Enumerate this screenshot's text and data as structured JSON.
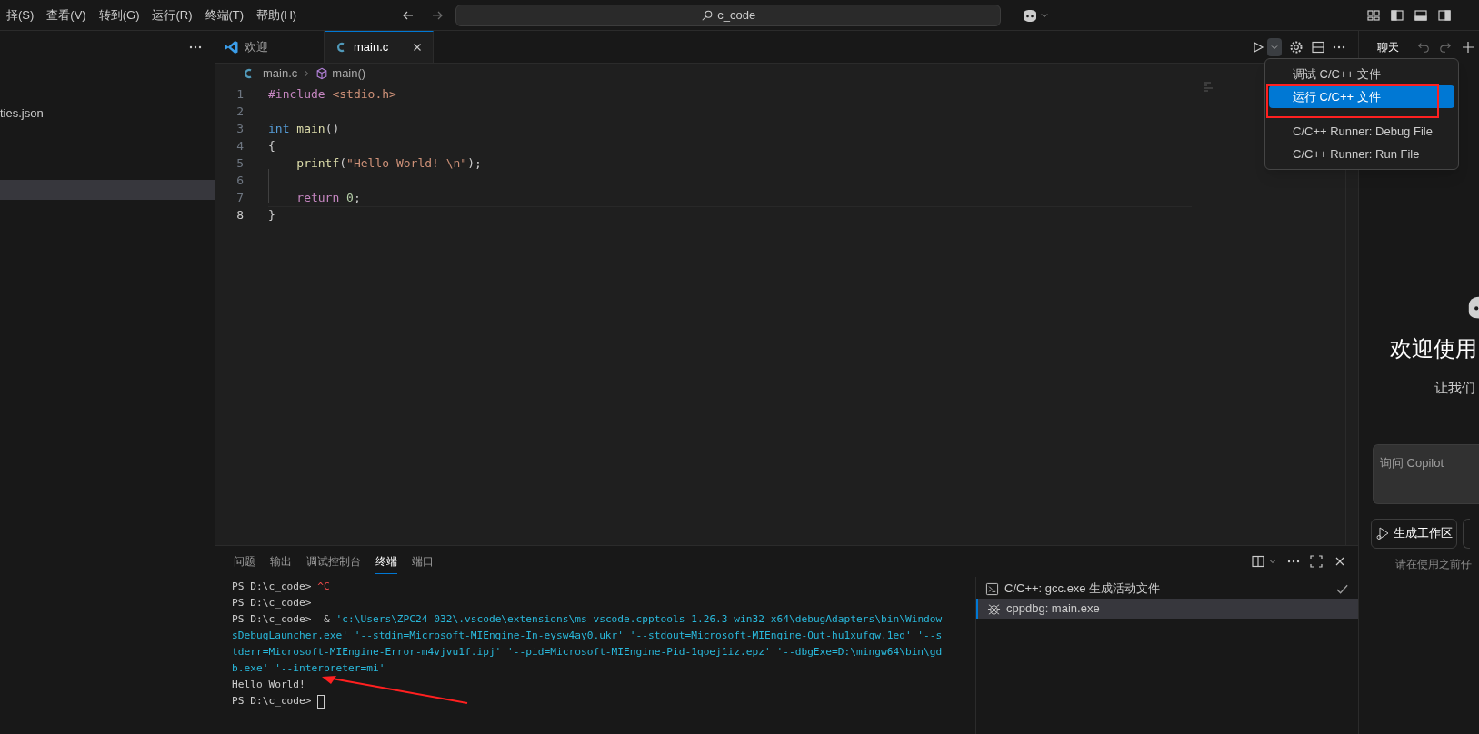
{
  "menu": [
    "择(S)",
    "查看(V)",
    "转到(G)",
    "运行(R)",
    "终端(T)",
    "帮助(H)"
  ],
  "search": {
    "value": "c_code"
  },
  "sidebar": {
    "items": [
      {
        "label": "ties.json",
        "selected": false
      },
      {
        "selected": true
      }
    ]
  },
  "tabs": [
    {
      "label": "欢迎",
      "kind": "welcome",
      "selected": false
    },
    {
      "label": "main.c",
      "kind": "c",
      "selected": true
    }
  ],
  "breadcrumb": [
    "main.c",
    "main()"
  ],
  "code": [
    {
      "number": "1",
      "current": false,
      "tokens": [
        {
          "kind": "keyword",
          "text": "#include"
        },
        {
          "kind": "string",
          "text": " <stdio.h>"
        }
      ]
    },
    {
      "number": "2",
      "current": false
    },
    {
      "number": "3",
      "current": false,
      "tokens": [
        {
          "kind": "type",
          "text": "int"
        },
        {
          "kind": "function",
          "text": " main"
        },
        {
          "kind": "plain",
          "text": "()"
        }
      ]
    },
    {
      "number": "4",
      "current": false,
      "tokens": [
        {
          "kind": "plain",
          "text": "{"
        }
      ]
    },
    {
      "number": "5",
      "current": false,
      "tokens": [
        {
          "kind": "function",
          "text": "    printf"
        },
        {
          "kind": "plain",
          "text": "("
        },
        {
          "kind": "string",
          "text": "\"Hello World! \\n\""
        },
        {
          "kind": "plain",
          "text": ");"
        }
      ]
    },
    {
      "number": "6",
      "current": false
    },
    {
      "number": "7",
      "current": false,
      "tokens": [
        {
          "kind": "keyword",
          "text": "    return"
        },
        {
          "kind": "number",
          "text": " 0"
        },
        {
          "kind": "plain",
          "text": ";"
        }
      ]
    },
    {
      "number": "8",
      "current": true,
      "tokens": [
        {
          "kind": "plain",
          "text": "}"
        }
      ]
    }
  ],
  "run_menu": {
    "items": [
      {
        "label": "调试 C/C++ 文件",
        "selected": false,
        "separator_after": false
      },
      {
        "label": "运行 C/C++ 文件",
        "selected": true,
        "separator_after": true
      },
      {
        "label": "C/C++ Runner: Debug File",
        "selected": false,
        "separator_after": false
      },
      {
        "label": "C/C++ Runner: Run File",
        "selected": false,
        "separator_after": false
      }
    ]
  },
  "chat": {
    "title": "聊天",
    "heading": "欢迎使用",
    "subheading": "让我们",
    "input": {
      "placeholder": "询问 Copilot"
    },
    "button": "生成工作区",
    "footer": "请在使用之前仔"
  },
  "panel": {
    "tabs": [
      {
        "label": "问题",
        "selected": false
      },
      {
        "label": "输出",
        "selected": false
      },
      {
        "label": "调试控制台",
        "selected": false
      },
      {
        "label": "终端",
        "selected": true
      },
      {
        "label": "端口",
        "selected": false
      }
    ],
    "terminal": [
      [
        {
          "kind": "plain",
          "text": "PS D:\\c_code> "
        },
        {
          "kind": "error",
          "text": "^C"
        }
      ],
      [
        {
          "kind": "plain",
          "text": "PS D:\\c_code> "
        }
      ],
      [
        {
          "kind": "plain",
          "text": "PS D:\\c_code>  & "
        },
        {
          "kind": "path",
          "text": "'c:\\Users\\ZPC24-032\\.vscode\\extensions\\ms-vscode.cpptools-1.26.3-win32-x64\\debugAdapters\\bin\\Window"
        }
      ],
      [
        {
          "kind": "path",
          "text": "sDebugLauncher.exe' '--stdin=Microsoft-MIEngine-In-eysw4ay0.ukr' '--stdout=Microsoft-MIEngine-Out-hu1xufqw.1ed' '--s"
        }
      ],
      [
        {
          "kind": "path",
          "text": "tderr=Microsoft-MIEngine-Error-m4vjvu1f.ipj' '--pid=Microsoft-MIEngine-Pid-1qoej1iz.epz' '--dbgExe=D:\\mingw64\\bin\\gd"
        }
      ],
      [
        {
          "kind": "path",
          "text": "b.exe' '--interpreter=mi'"
        }
      ],
      [
        {
          "kind": "plain",
          "text": "Hello World!"
        }
      ],
      [
        {
          "kind": "plain",
          "text": "PS D:\\c_code> "
        },
        {
          "kind": "cursor"
        }
      ]
    ],
    "sessions": [
      {
        "label": "C/C++: gcc.exe 生成活动文件",
        "kind": "task",
        "selected": false,
        "done": true
      },
      {
        "label": "cppdbg: main.exe",
        "kind": "debug",
        "selected": true,
        "done": false
      }
    ]
  }
}
